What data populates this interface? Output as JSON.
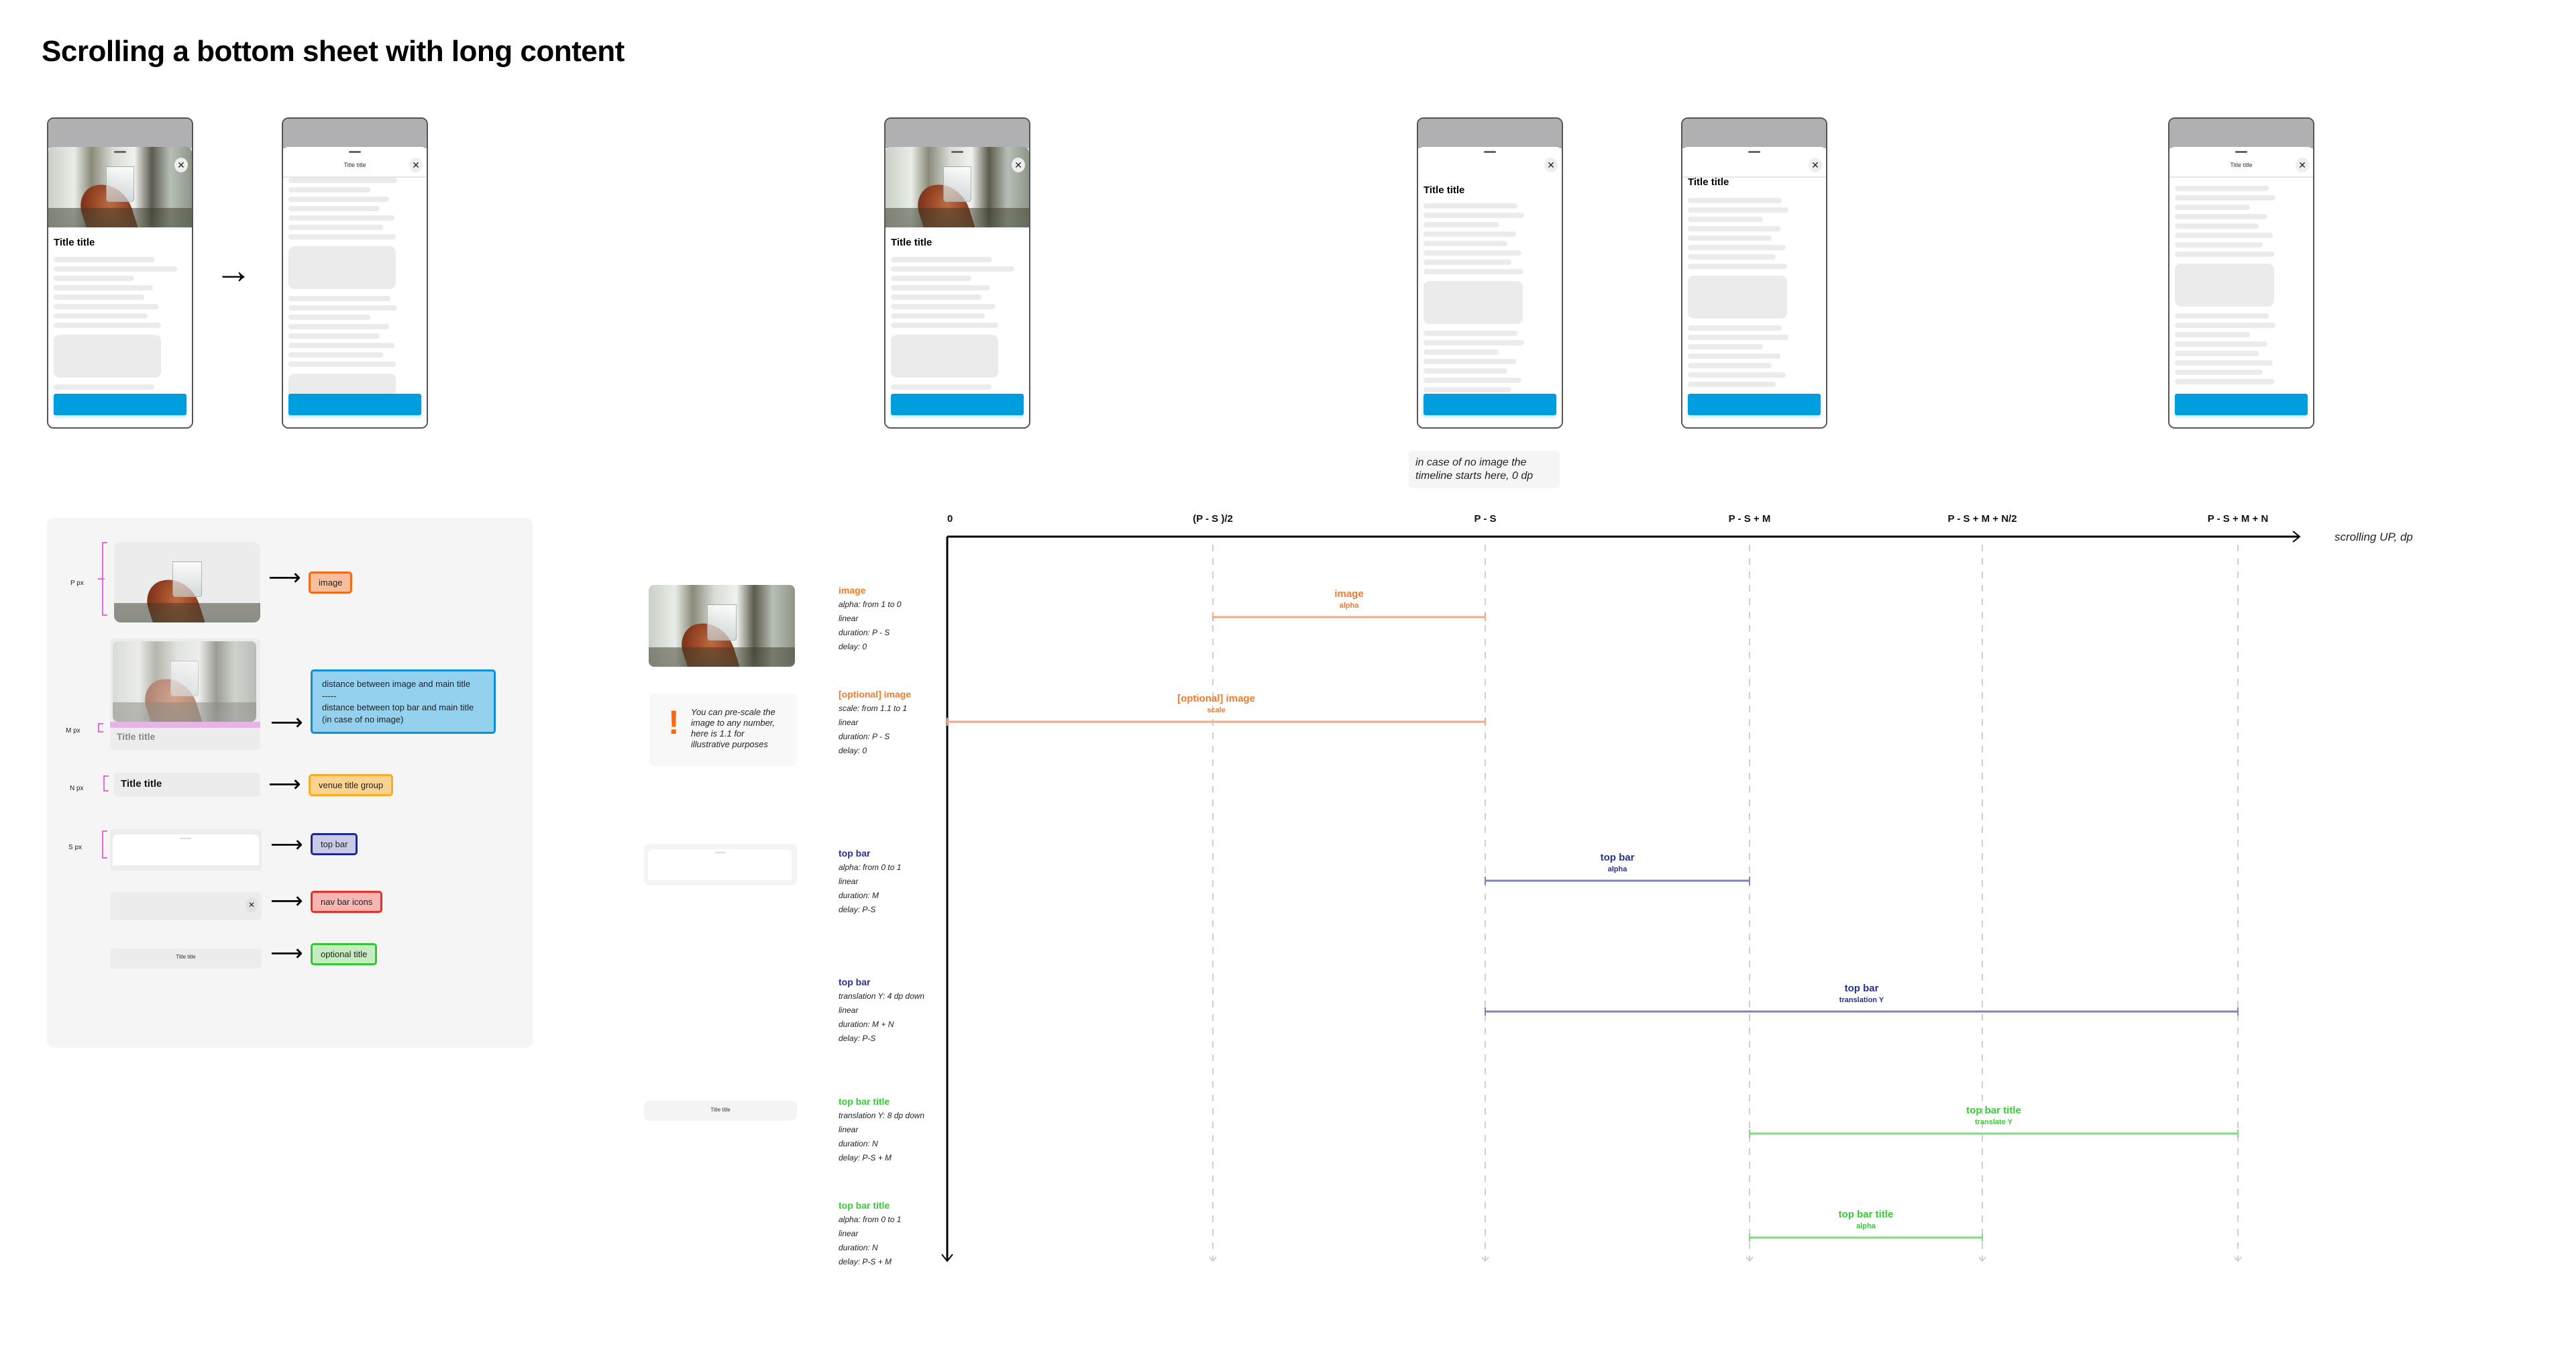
{
  "page": {
    "title": "Scrolling a bottom sheet with long content"
  },
  "colors": {
    "image": "#f07a2c",
    "image_line": "#f5a78a",
    "top_bar": "#25308f",
    "top_bar_line": "#7e84b8",
    "top_bar_title": "#33cc33",
    "top_bar_title_line": "#7fd77f",
    "cta": "#009ddf",
    "axis": "#000000",
    "guide": "#cfcfcf"
  },
  "intro_phones": [
    {
      "state": "expanded-with-image",
      "main_title": "Title title",
      "close_icon": "✕"
    },
    {
      "state": "scrolled-collapsed",
      "bar_title": "Title title",
      "close_icon": "✕"
    }
  ],
  "flow_arrow": "→",
  "timeline_phones": [
    {
      "state": "image",
      "main_title": "Title title",
      "close_icon": "✕"
    },
    {
      "state": "image-faded",
      "main_title": "Title title",
      "close_icon": "✕"
    },
    {
      "state": "top-bar-visible",
      "main_title": "Title title",
      "close_icon": "✕"
    },
    {
      "state": "bar-title-visible",
      "bar_title": "Title title",
      "close_icon": "✕"
    }
  ],
  "no_image_note": "in case of no image the timeline starts here, 0 dp",
  "legend": {
    "items": [
      {
        "dim": "P px",
        "tag": "image",
        "fill": "#f9bf9d",
        "border": "#f06a1a"
      },
      {
        "dim": "M px",
        "tag_lines": [
          "distance between image and main title",
          "-----",
          "distance between top bar and main title (in case of no image)"
        ],
        "fill": "#93d1ef",
        "border": "#0f8fd6",
        "sample_title": "Title title"
      },
      {
        "dim": "N px",
        "tag": "venue title group",
        "fill": "#fbd38e",
        "border": "#f5ad28",
        "sample_title": "Title title"
      },
      {
        "dim": "S px",
        "tag": "top bar",
        "fill": "#c9cbe6",
        "border": "#1c2890"
      },
      {
        "dim": "",
        "tag": "nav bar icons",
        "fill": "#f7b6b1",
        "border": "#e6302a",
        "close_icon": "✕"
      },
      {
        "dim": "",
        "tag": "optional title",
        "fill": "#c6edc0",
        "border": "#33c633",
        "sample_title": "Title title"
      }
    ]
  },
  "warning": {
    "icon": "!",
    "text": "You can pre-scale the image to any number, here is 1.1 for illustrative purposes"
  },
  "optional_title_thumb": "Title title",
  "chart_data": {
    "type": "timeline",
    "title": "",
    "xlabel": "scrolling UP, dp",
    "ticks": [
      "0",
      "(P - S )/2",
      "P - S",
      "P - S + M",
      "P - S + M + N/2",
      "P - S + M + N"
    ],
    "tick_positions_units": [
      0,
      0.5,
      1,
      2,
      2.5,
      3
    ],
    "animations": [
      {
        "name": "image",
        "property": "alpha",
        "spec": [
          "alpha: from 1 to 0",
          "linear",
          "duration: P - S",
          "delay:  0"
        ],
        "start_tick": 1,
        "end_tick": 2,
        "color_key": "image"
      },
      {
        "name": "[optional] image",
        "property": "scale",
        "spec": [
          "scale: from 1.1 to 1",
          "linear",
          "duration: P - S",
          "delay:  0"
        ],
        "start_tick": 0,
        "end_tick": 2,
        "color_key": "image"
      },
      {
        "name": "top bar",
        "property": "alpha",
        "spec": [
          "alpha: from 0 to 1",
          "linear",
          "duration: M",
          "delay:  P-S"
        ],
        "start_tick": 2,
        "end_tick": 3,
        "color_key": "top_bar"
      },
      {
        "name": "top bar",
        "property": "translation Y",
        "spec": [
          "translation Y: 4 dp down",
          "linear",
          "duration: M + N",
          "delay:  P-S"
        ],
        "start_tick": 2,
        "end_tick": 5,
        "color_key": "top_bar"
      },
      {
        "name": "top bar title",
        "property": "translate Y",
        "spec": [
          "translation Y: 8 dp down",
          "linear",
          "duration: N",
          "delay:  P-S + M"
        ],
        "start_tick": 3,
        "end_tick": 5,
        "color_key": "top_bar_title"
      },
      {
        "name": "top bar title",
        "property": "alpha",
        "spec": [
          "alpha: from 0 to 1",
          "linear",
          "duration: N",
          "delay:  P-S + M"
        ],
        "start_tick": 3,
        "end_tick": 4,
        "color_key": "top_bar_title"
      }
    ]
  }
}
